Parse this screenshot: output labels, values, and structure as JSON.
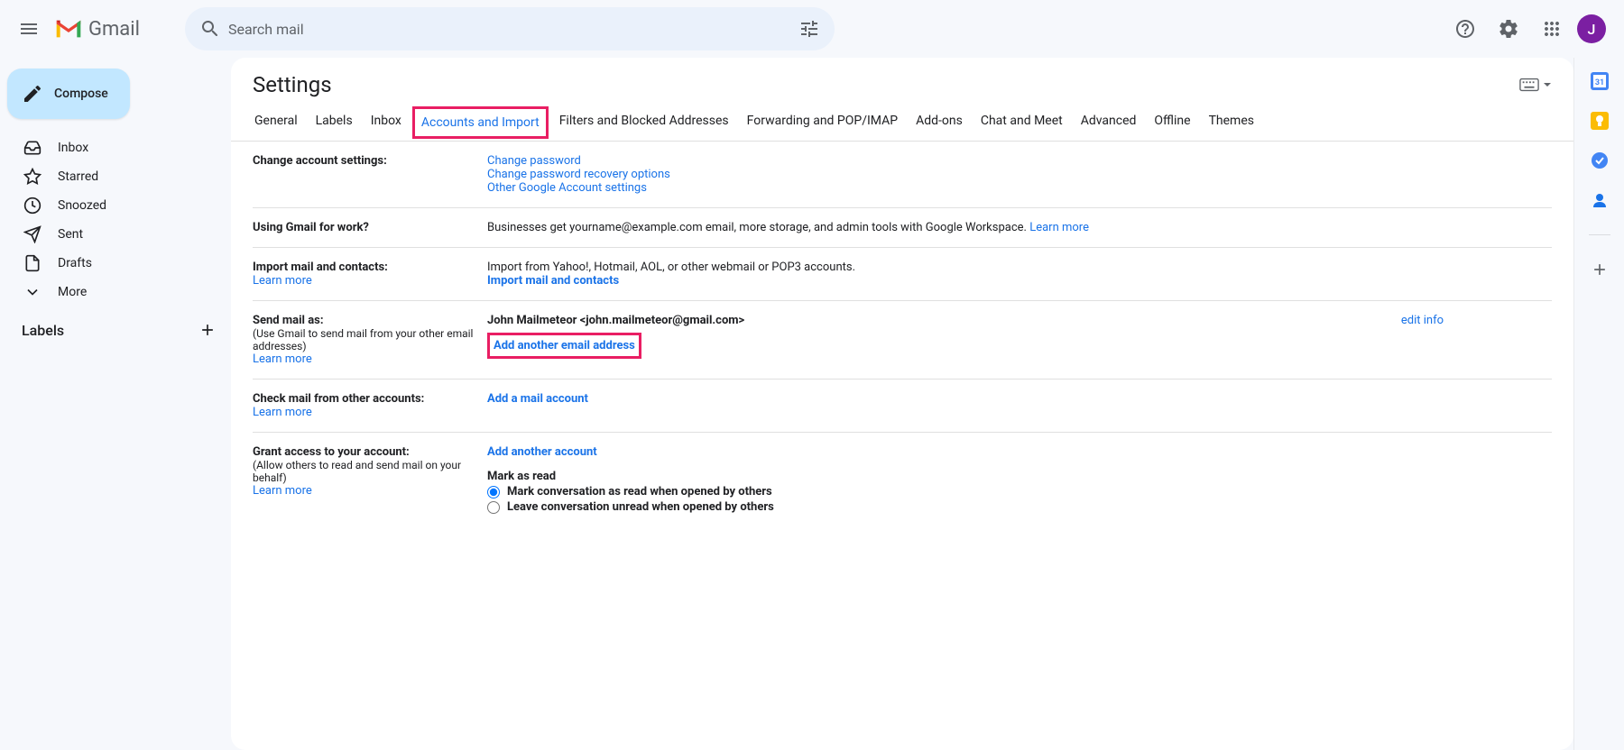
{
  "header": {
    "logo_text": "Gmail",
    "search_placeholder": "Search mail",
    "avatar_initial": "J"
  },
  "sidebar": {
    "compose_label": "Compose",
    "items": [
      {
        "label": "Inbox",
        "icon": "inbox"
      },
      {
        "label": "Starred",
        "icon": "star"
      },
      {
        "label": "Snoozed",
        "icon": "clock"
      },
      {
        "label": "Sent",
        "icon": "send"
      },
      {
        "label": "Drafts",
        "icon": "draft"
      },
      {
        "label": "More",
        "icon": "expand"
      }
    ],
    "labels_header": "Labels"
  },
  "settings": {
    "title": "Settings",
    "tabs": [
      "General",
      "Labels",
      "Inbox",
      "Accounts and Import",
      "Filters and Blocked Addresses",
      "Forwarding and POP/IMAP",
      "Add-ons",
      "Chat and Meet",
      "Advanced",
      "Offline",
      "Themes"
    ],
    "active_tab": "Accounts and Import",
    "sections": {
      "change_account": {
        "title": "Change account settings:",
        "links": [
          "Change password",
          "Change password recovery options",
          "Other Google Account settings"
        ]
      },
      "using_work": {
        "title": "Using Gmail for work?",
        "text": "Businesses get yourname@example.com email, more storage, and admin tools with Google Workspace. ",
        "learn_more": "Learn more"
      },
      "import_mail": {
        "title": "Import mail and contacts:",
        "learn_more": "Learn more",
        "text": "Import from Yahoo!, Hotmail, AOL, or other webmail or POP3 accounts.",
        "action": "Import mail and contacts"
      },
      "send_as": {
        "title": "Send mail as:",
        "desc": "(Use Gmail to send mail from your other email addresses)",
        "learn_more": "Learn more",
        "identity": "John Mailmeteor <john.mailmeteor@gmail.com>",
        "edit": "edit info",
        "action": "Add another email address"
      },
      "check_mail": {
        "title": "Check mail from other accounts:",
        "learn_more": "Learn more",
        "action": "Add a mail account"
      },
      "grant_access": {
        "title": "Grant access to your account:",
        "desc": "(Allow others to read and send mail on your behalf)",
        "learn_more": "Learn more",
        "action": "Add another account",
        "mark_as_read": "Mark as read",
        "option1": "Mark conversation as read when opened by others",
        "option2": "Leave conversation unread when opened by others"
      }
    }
  }
}
